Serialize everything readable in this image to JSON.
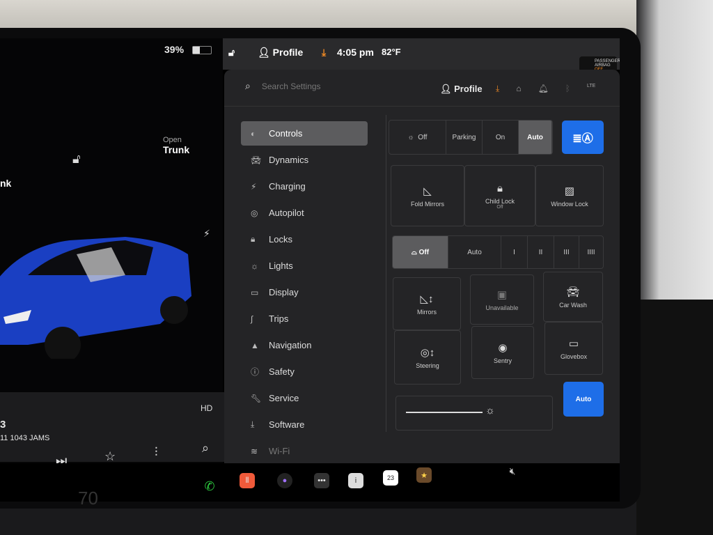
{
  "left": {
    "battery": "39%",
    "battery_level": 0.39,
    "open_trunk_label": "Open",
    "trunk_label": "Trunk",
    "partial_label": "nk"
  },
  "media": {
    "title": "3",
    "subtitle": "11 1043 JAMS"
  },
  "statusbar": {
    "profile": "Profile",
    "time": "4:05 pm",
    "temp": "82°F",
    "airbag_line1": "PASSENGER",
    "airbag_line2": "AIRBAG",
    "airbag_state": "OFF"
  },
  "settings": {
    "search_placeholder": "Search Settings",
    "profile": "Profile",
    "lte": "LTE",
    "nav": [
      "Controls",
      "Dynamics",
      "Charging",
      "Autopilot",
      "Locks",
      "Lights",
      "Display",
      "Trips",
      "Navigation",
      "Safety",
      "Service",
      "Software",
      "Wi-Fi"
    ],
    "nav_selected": "Controls",
    "lights": {
      "options": [
        "Off",
        "Parking",
        "On",
        "Auto"
      ],
      "selected": "Auto"
    },
    "row2": [
      {
        "label": "Fold Mirrors"
      },
      {
        "label": "Child Lock",
        "sub": "Off"
      },
      {
        "label": "Window Lock"
      }
    ],
    "wipers": {
      "options": [
        "Off",
        "Auto",
        "I",
        "II",
        "III",
        "IIII"
      ],
      "selected": "Off"
    },
    "tiles": [
      "Mirrors",
      "Unavailable",
      "Car Wash",
      "Steering",
      "Sentry",
      "Glovebox"
    ],
    "brightness_auto": "Auto"
  },
  "dock": {
    "calendar_day": "23"
  },
  "speed": "70",
  "colors": {
    "accent": "#1e6ee8",
    "warning": "#f08a24",
    "phone": "#2ecc40"
  }
}
